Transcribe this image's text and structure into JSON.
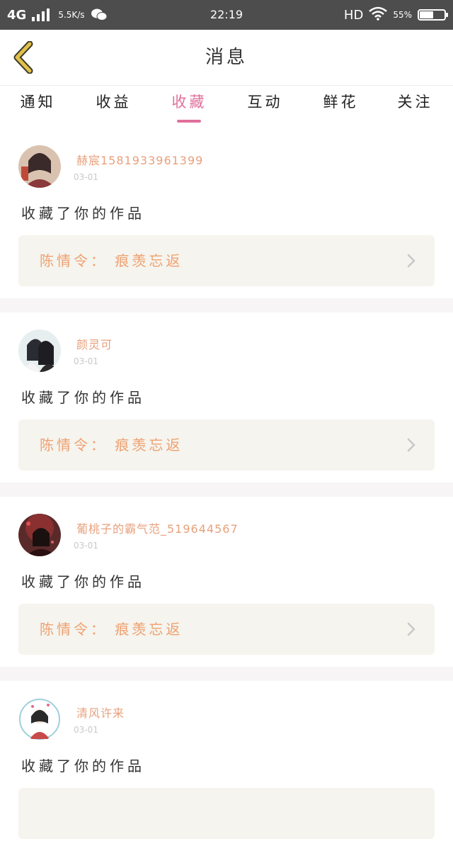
{
  "status_bar": {
    "network": "4G",
    "speed": "5.5K/s",
    "time": "22:19",
    "hd": "HD",
    "battery_percent": "55%"
  },
  "header": {
    "title": "消息"
  },
  "tabs": [
    {
      "label": "通知",
      "active": false
    },
    {
      "label": "收益",
      "active": false
    },
    {
      "label": "收藏",
      "active": true
    },
    {
      "label": "互动",
      "active": false
    },
    {
      "label": "鲜花",
      "active": false
    },
    {
      "label": "关注",
      "active": false
    }
  ],
  "notifications": [
    {
      "username": "赫宸15819339613​99",
      "date": "03-01",
      "action": "收藏了你的作品",
      "work": "陈情令： 痕羡忘返"
    },
    {
      "username": "颜灵可",
      "date": "03-01",
      "action": "收藏了你的作品",
      "work": "陈情令： 痕羡忘返"
    },
    {
      "username": "葡桃子的霸气范_519644567",
      "date": "03-01",
      "action": "收藏了你的作品",
      "work": "陈情令： 痕羡忘返"
    },
    {
      "username": "清风许来",
      "date": "03-01",
      "action": "收藏了你的作品",
      "work": ""
    }
  ],
  "colors": {
    "accent": "#e0709b",
    "username": "#e8a07c",
    "work_title": "#f0a070",
    "back_arrow": "#e2c04a"
  }
}
